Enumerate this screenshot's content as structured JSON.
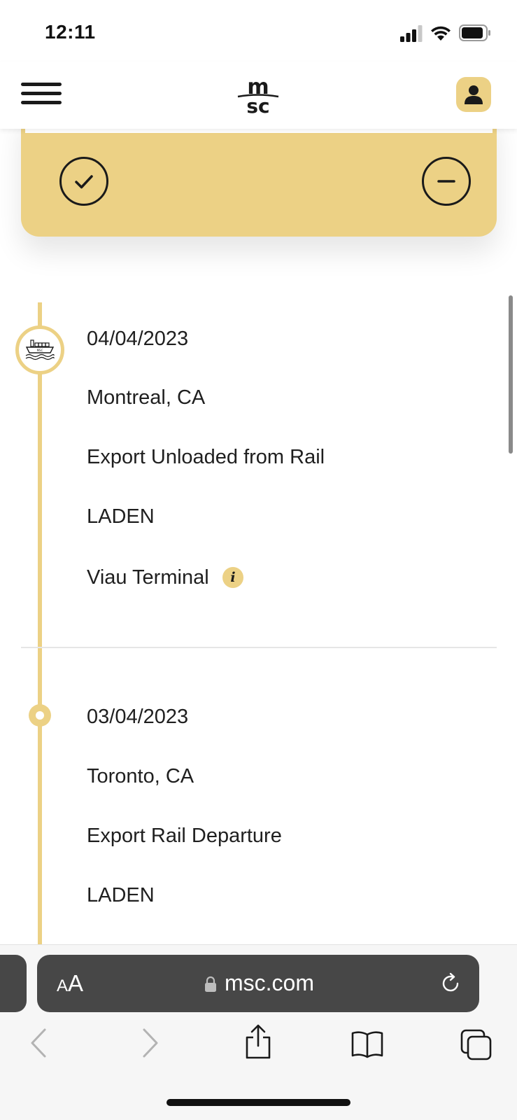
{
  "status_bar": {
    "time": "12:11"
  },
  "app_header": {
    "logo_text_top": "m",
    "logo_text_bottom": "sc"
  },
  "timeline": {
    "events": [
      {
        "date": "04/04/2023",
        "location": "Montreal, CA",
        "description": "Export Unloaded from Rail",
        "status": "LADEN",
        "facility": "Viau Terminal",
        "icon": "ship-icon"
      },
      {
        "date": "03/04/2023",
        "location": "Toronto, CA",
        "description": "Export Rail Departure",
        "status": "LADEN",
        "icon": "dot-icon"
      }
    ]
  },
  "browser": {
    "text_size_small": "A",
    "text_size_large": "A",
    "url": "msc.com"
  },
  "colors": {
    "accent": "#ecd185",
    "text": "#1f1f1f",
    "browser_pill": "#474747"
  }
}
